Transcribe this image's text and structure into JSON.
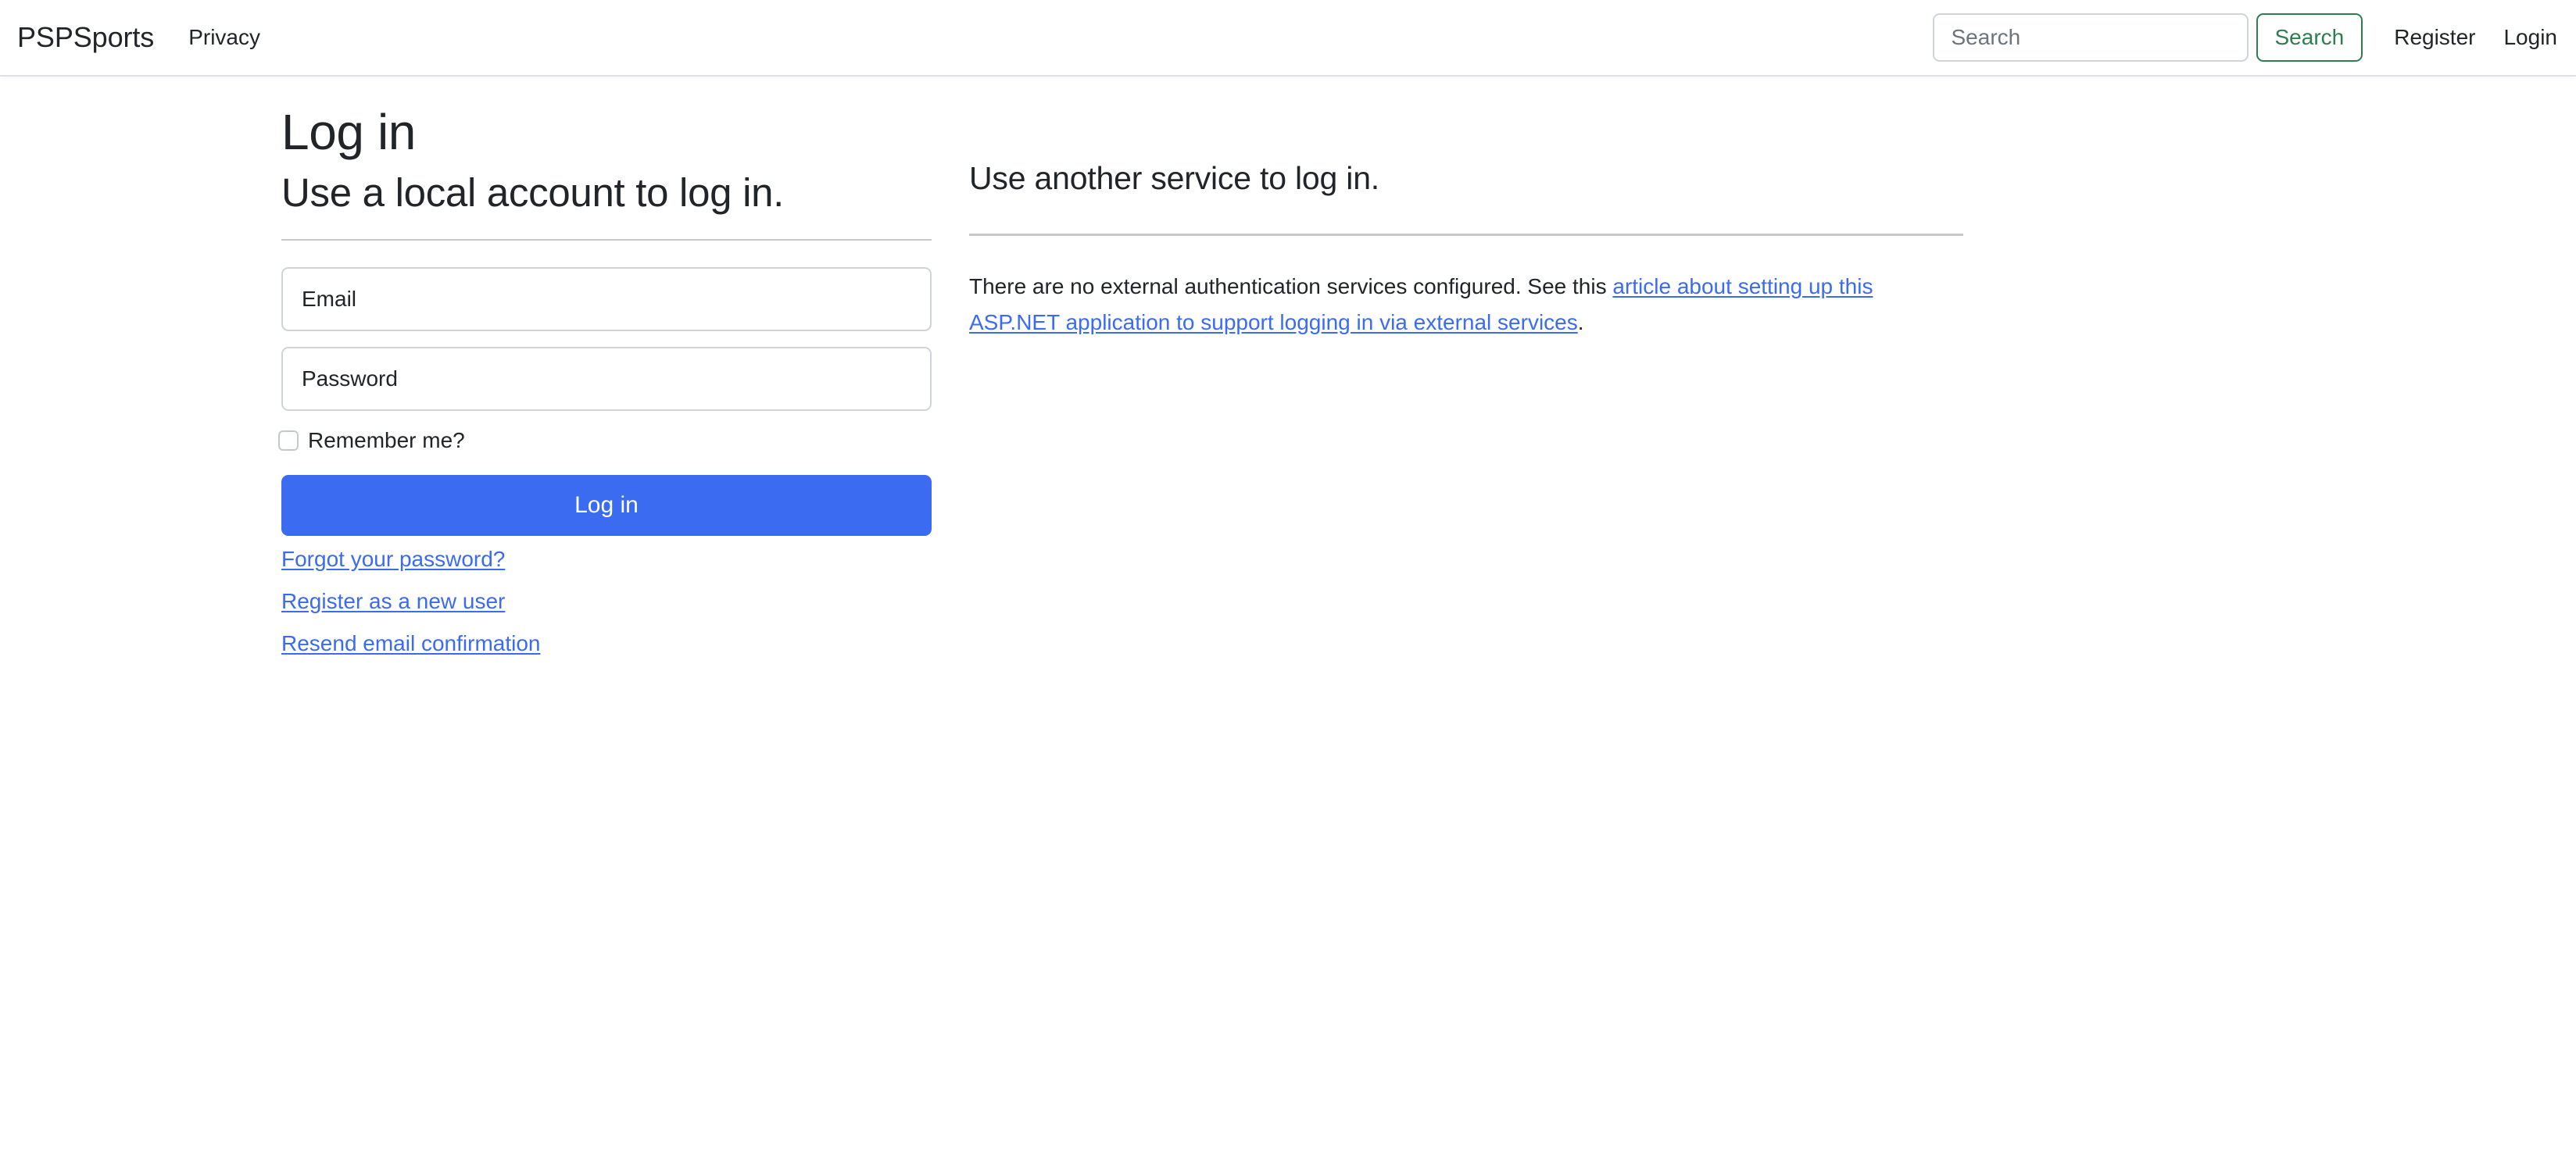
{
  "navbar": {
    "brand": "PSPSports",
    "left_links": [
      {
        "label": "Privacy"
      }
    ],
    "search": {
      "placeholder": "Search",
      "value": "",
      "button_label": "Search",
      "button_color": "#2e7d4f"
    },
    "auth_links": [
      {
        "label": "Register"
      },
      {
        "label": "Login"
      }
    ]
  },
  "main": {
    "page_title": "Log in",
    "local_account": {
      "section_title": "Use a local account to log in.",
      "email_label": "Email",
      "email_value": "",
      "password_label": "Password",
      "password_value": "",
      "remember_label": "Remember me?",
      "remember_checked": false,
      "submit_label": "Log in",
      "submit_color": "#3b6bf0",
      "links": [
        {
          "label": "Forgot your password?"
        },
        {
          "label": "Register as a new user"
        },
        {
          "label": "Resend email confirmation"
        }
      ]
    },
    "external_login": {
      "section_title": "Use another service to log in.",
      "text_before": "There are no external authentication services configured. See this ",
      "link_text": "article about setting up this ASP.NET application to support logging in via external services",
      "text_after": "."
    }
  }
}
